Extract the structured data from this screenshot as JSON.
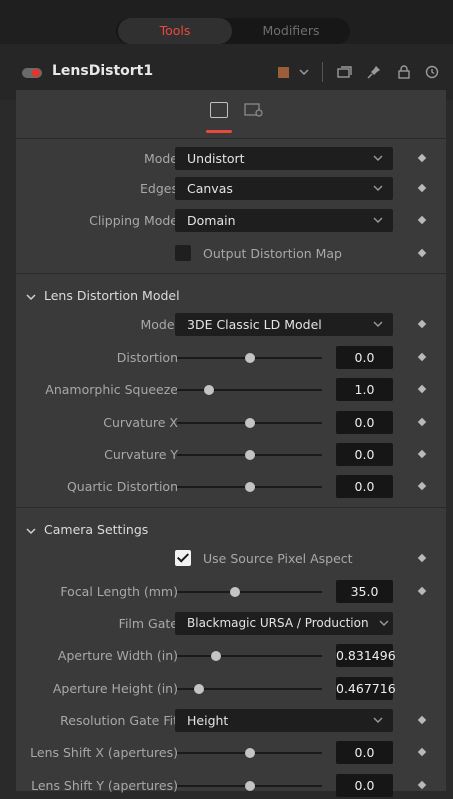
{
  "tabs": {
    "tools": "Tools",
    "modifiers": "Modifiers"
  },
  "colors": {
    "accent": "#e8493d",
    "node_color": "#9a5f3a"
  },
  "header": {
    "tool_name": "LensDistort1",
    "icons": [
      "version-icon",
      "pin-icon",
      "lock-icon",
      "reset-icon"
    ]
  },
  "rows": {
    "mode": {
      "label": "Mode",
      "value": "Undistort"
    },
    "edges": {
      "label": "Edges",
      "value": "Canvas"
    },
    "clipping": {
      "label": "Clipping Mode",
      "value": "Domain"
    },
    "output_map": {
      "label": "Output Distortion Map",
      "checked": false
    }
  },
  "lens_section": {
    "title": "Lens Distortion Model",
    "model": {
      "label": "Model",
      "value": "3DE Classic LD Model"
    },
    "distortion": {
      "label": "Distortion",
      "value": "0.0"
    },
    "anamorphic": {
      "label": "Anamorphic Squeeze",
      "value": "1.0"
    },
    "curvature_x": {
      "label": "Curvature X",
      "value": "0.0"
    },
    "curvature_y": {
      "label": "Curvature Y",
      "value": "0.0"
    },
    "quartic": {
      "label": "Quartic Distortion",
      "value": "0.0"
    }
  },
  "camera_section": {
    "title": "Camera Settings",
    "use_pixel_aspect": {
      "label": "Use Source Pixel Aspect",
      "checked": true
    },
    "focal_length": {
      "label": "Focal Length (mm)",
      "value": "35.0"
    },
    "film_gate": {
      "label": "Film Gate",
      "value": "Blackmagic URSA / Production"
    },
    "aperture_width": {
      "label": "Aperture Width (in)",
      "value": "0.831496"
    },
    "aperture_height": {
      "label": "Aperture Height (in)",
      "value": "0.467716"
    },
    "resolution_fit": {
      "label": "Resolution Gate Fit",
      "value": "Height"
    },
    "lens_shift_x": {
      "label": "Lens Shift X (apertures)",
      "value": "0.0"
    },
    "lens_shift_y": {
      "label": "Lens Shift Y (apertures)",
      "value": "0.0"
    }
  }
}
